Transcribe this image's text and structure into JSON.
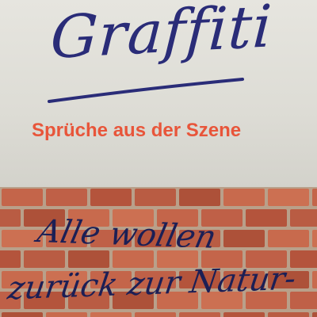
{
  "cover": {
    "title": "Graffiti",
    "subtitle": "Sprüche aus der Szene",
    "graffiti_line_1": "Alle wollen",
    "graffiti_line_2": "zurück zur Natur-"
  },
  "colors": {
    "panel": "#e2e1da",
    "title_ink": "#2a2c78",
    "subtitle": "#e8553a",
    "brick": "#c4654a",
    "mortar": "#b9a08a",
    "scrawl_ink": "#1c1f55"
  }
}
